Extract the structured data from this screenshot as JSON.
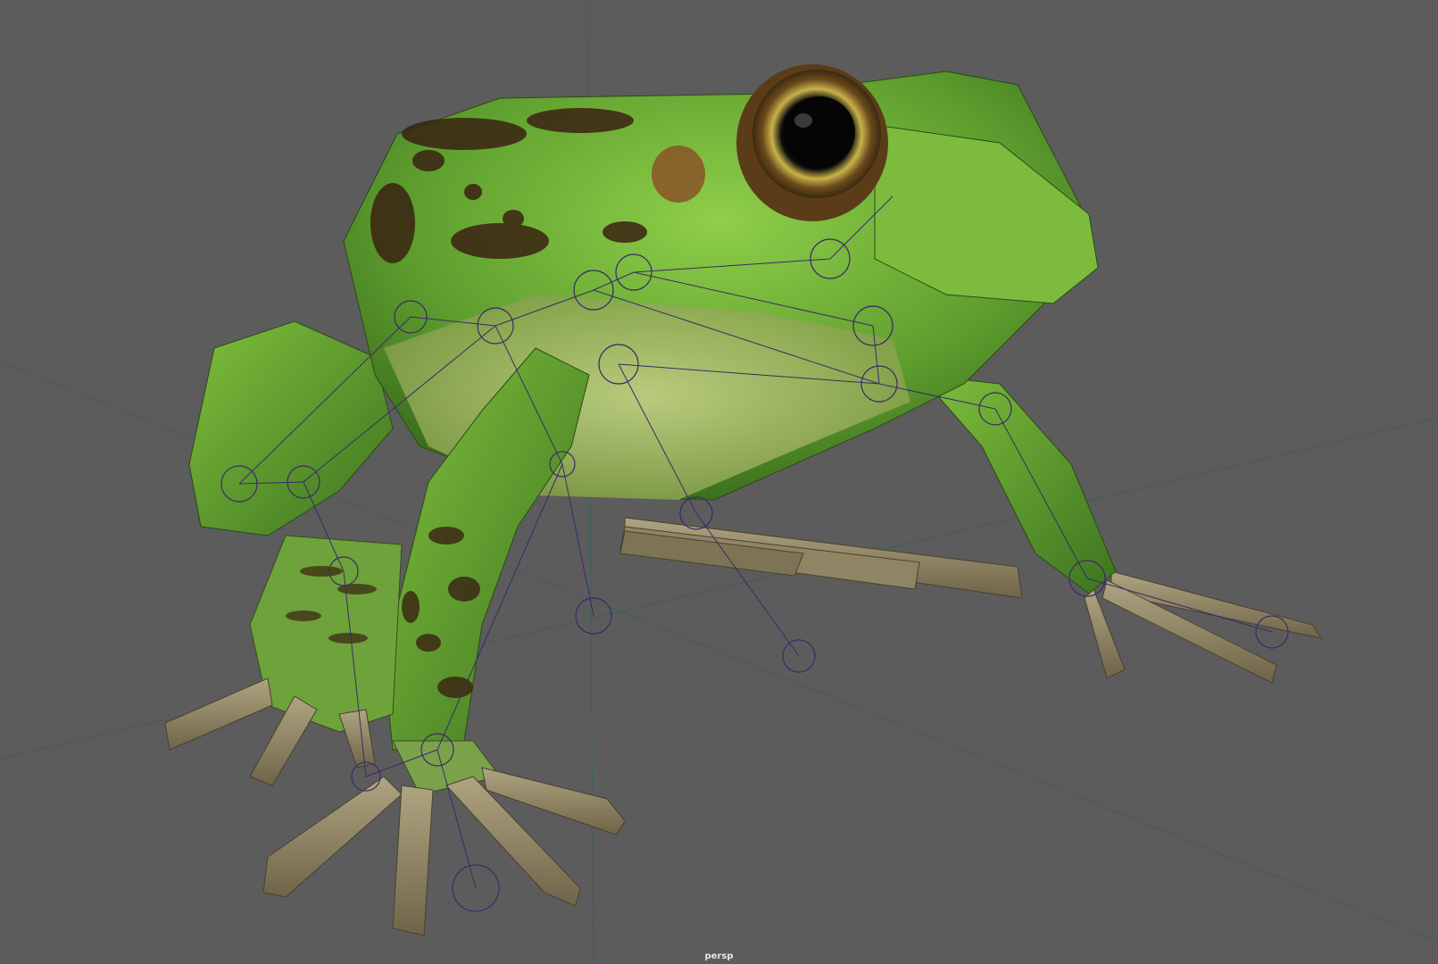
{
  "viewport": {
    "camera_label": "persp",
    "background_color": "#5c5c5c",
    "grid_color": "#3f5e59",
    "rig_color": "#3b2a68"
  },
  "model": {
    "skin_green": "#5e9e2e",
    "belly_color": "#a7b86a",
    "toe_color": "#8a8161",
    "spot_color": "#3a2212"
  }
}
